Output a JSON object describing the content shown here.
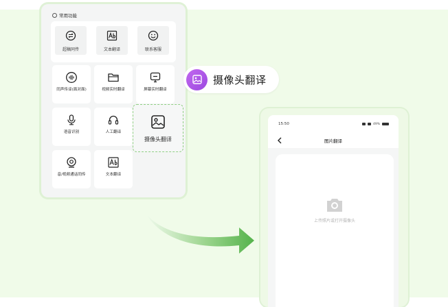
{
  "panel": {
    "header_label": "常用功能",
    "common_items": [
      {
        "label": "超稿同传",
        "icon": "swap-circle-icon"
      },
      {
        "label": "文本翻译",
        "icon": "text-translate-icon"
      },
      {
        "label": "联系客服",
        "icon": "smiley-service-icon"
      }
    ],
    "grid_items": [
      {
        "label": "同声传译(面对面)",
        "icon": "audio-wave-icon"
      },
      {
        "label": "视频实时翻译",
        "icon": "folder-icon"
      },
      {
        "label": "屏幕实时翻译",
        "icon": "screen-icon"
      },
      {
        "label": "语音识别",
        "icon": "microphone-icon"
      },
      {
        "label": "人工翻译",
        "icon": "headset-icon"
      },
      {
        "label": "音/视频通话同传",
        "icon": "webcam-icon"
      },
      {
        "label": "文本翻译",
        "icon": "text-translate-icon"
      }
    ],
    "highlight_item": {
      "label": "摄像头翻译",
      "icon": "image-scan-icon"
    }
  },
  "callout": {
    "label": "摄像头翻译",
    "icon": "image-icon",
    "color": "#b35fea"
  },
  "phone": {
    "status": {
      "time": "15:50",
      "battery": "49%"
    },
    "title": "图片翻译",
    "upload_hint": "上传照片或打开摄像头"
  },
  "colors": {
    "background_tint": "#f0fbe9",
    "arrow_start": "#e3f5dc",
    "arrow_end": "#55b34c",
    "highlight_border": "#8fcf83"
  }
}
